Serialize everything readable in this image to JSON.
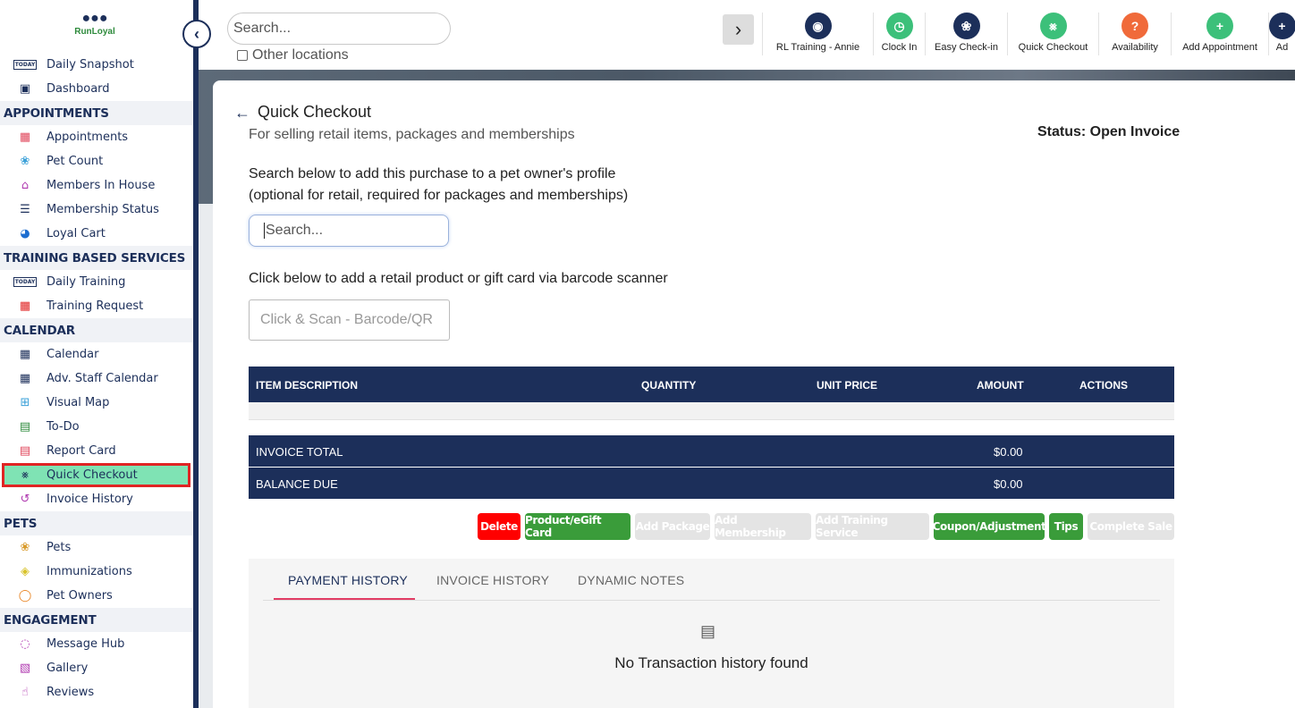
{
  "brand": {
    "name": "RunLoyal"
  },
  "sidebar": {
    "items": [
      {
        "type": "item",
        "label": "Daily Snapshot",
        "icon": "today-icon",
        "color": "#1c2f5a"
      },
      {
        "type": "item",
        "label": "Dashboard",
        "icon": "dashboard-icon",
        "color": "#1c2f5a"
      },
      {
        "type": "section",
        "label": "APPOINTMENTS"
      },
      {
        "type": "item",
        "label": "Appointments",
        "icon": "calendar-grid-icon",
        "color": "#e0455a"
      },
      {
        "type": "item",
        "label": "Pet Count",
        "icon": "paws-icon",
        "color": "#3aa0d8"
      },
      {
        "type": "item",
        "label": "Members In House",
        "icon": "house-icon",
        "color": "#b03ab0"
      },
      {
        "type": "item",
        "label": "Membership Status",
        "icon": "list-icon",
        "color": "#1c2f5a"
      },
      {
        "type": "item",
        "label": "Loyal Cart",
        "icon": "cart-paw-icon",
        "color": "#1c6dd0"
      },
      {
        "type": "section",
        "label": "TRAINING BASED SERVICES"
      },
      {
        "type": "item",
        "label": "Daily Training",
        "icon": "today-training-icon",
        "color": "#1c2f5a"
      },
      {
        "type": "item",
        "label": "Training Request",
        "icon": "training-request-icon",
        "color": "#e02424"
      },
      {
        "type": "section",
        "label": "CALENDAR"
      },
      {
        "type": "item",
        "label": "Calendar",
        "icon": "calendar-icon",
        "color": "#1c2f5a"
      },
      {
        "type": "item",
        "label": "Adv. Staff Calendar",
        "icon": "staff-calendar-icon",
        "color": "#1c2f5a"
      },
      {
        "type": "item",
        "label": "Visual Map",
        "icon": "map-icon",
        "color": "#3aa0d8"
      },
      {
        "type": "item",
        "label": "To-Do",
        "icon": "todo-icon",
        "color": "#2e8b3c"
      },
      {
        "type": "item",
        "label": "Report Card",
        "icon": "report-card-icon",
        "color": "#e0455a"
      },
      {
        "type": "item",
        "label": "Quick Checkout",
        "icon": "cart-icon",
        "color": "#1c2f5a",
        "active": true
      },
      {
        "type": "item",
        "label": "Invoice History",
        "icon": "invoice-history-icon",
        "color": "#b03ab0"
      },
      {
        "type": "section",
        "label": "PETS"
      },
      {
        "type": "item",
        "label": "Pets",
        "icon": "paw-icon",
        "color": "#d89a2a"
      },
      {
        "type": "item",
        "label": "Immunizations",
        "icon": "shield-icon",
        "color": "#d8c22a"
      },
      {
        "type": "item",
        "label": "Pet Owners",
        "icon": "person-icon",
        "color": "#e8801c"
      },
      {
        "type": "section",
        "label": "ENGAGEMENT"
      },
      {
        "type": "item",
        "label": "Message Hub",
        "icon": "chat-icon",
        "color": "#b03ab0"
      },
      {
        "type": "item",
        "label": "Gallery",
        "icon": "gallery-icon",
        "color": "#b03ab0"
      },
      {
        "type": "item",
        "label": "Reviews",
        "icon": "thumbs-up-icon",
        "color": "#b03ab0"
      }
    ]
  },
  "topbar": {
    "search_placeholder": "Search...",
    "other_locations": "Other locations",
    "quick_actions": [
      {
        "label": "RL Training - Annie",
        "icon": "location-icon",
        "color": "#1c2f5a"
      },
      {
        "label": "Clock In",
        "icon": "clock-icon",
        "color": "#3cc07a"
      },
      {
        "label": "Easy Check-in",
        "icon": "paw-icon",
        "color": "#1c2f5a"
      },
      {
        "label": "Quick Checkout",
        "icon": "cart-icon",
        "color": "#3cc07a"
      },
      {
        "label": "Availability",
        "icon": "availability-icon",
        "color": "#f06a3a"
      },
      {
        "label": "Add Appointment",
        "icon": "add-calendar-icon",
        "color": "#3cc07a"
      },
      {
        "label": "Ad",
        "icon": "add-icon",
        "color": "#1c2f5a"
      }
    ]
  },
  "page": {
    "title": "Quick Checkout",
    "subtitle": "For selling retail items, packages and memberships",
    "status": "Status: Open Invoice",
    "owner_instruction_1": "Search below to add this purchase to a pet owner's profile",
    "owner_instruction_2": "(optional for retail, required for packages and memberships)",
    "owner_search_placeholder": "Search...",
    "scan_instruction": "Click below to add a retail product or gift card via barcode scanner",
    "scan_placeholder": "Click & Scan - Barcode/QR"
  },
  "items_table": {
    "columns": [
      "ITEM DESCRIPTION",
      "QUANTITY",
      "UNIT PRICE",
      "AMOUNT",
      "ACTIONS"
    ],
    "rows": []
  },
  "totals": {
    "invoice_total_label": "INVOICE TOTAL",
    "invoice_total_value": "$0.00",
    "balance_due_label": "BALANCE DUE",
    "balance_due_value": "$0.00"
  },
  "actions": {
    "delete": "Delete",
    "product_gift": "Product/eGift Card",
    "add_package": "Add Package",
    "add_membership": "Add Membership",
    "add_training": "Add Training Service",
    "coupon": "Coupon/Adjustment",
    "tips": "Tips",
    "complete_sale": "Complete Sale"
  },
  "history": {
    "tabs": [
      "PAYMENT HISTORY",
      "INVOICE HISTORY",
      "DYNAMIC NOTES"
    ],
    "active_tab": "PAYMENT HISTORY",
    "empty_message": "No Transaction history found"
  }
}
